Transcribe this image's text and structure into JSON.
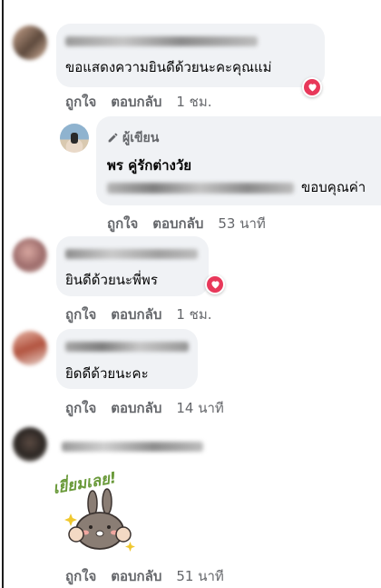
{
  "colors": {
    "accent": "#e8385a",
    "bubble": "#f0f2f5",
    "secondary_text": "#65676b"
  },
  "comments": [
    {
      "text": "ขอแสดงความยินดีด้วยนะคะคุณแม่",
      "like": "ถูกใจ",
      "reply": "ตอบกลับ",
      "time": "1 ชม.",
      "reaction": "heart"
    },
    {
      "author_label": "ผู้เขียน",
      "author_name": "พร คู่รักต่างวัย",
      "text_suffix": "ขอบคุณค่า",
      "like": "ถูกใจ",
      "reply": "ตอบกลับ",
      "time": "53 นาที"
    },
    {
      "text": "ยินดีด้วยนะพี่พร",
      "like": "ถูกใจ",
      "reply": "ตอบกลับ",
      "time": "1 ชม.",
      "reaction": "heart"
    },
    {
      "text": "ยิดดีด้วยนะคะ",
      "like": "ถูกใจ",
      "reply": "ตอบกลับ",
      "time": "14 นาที"
    },
    {
      "sticker_text": "เยี่ยมเลย!",
      "sticker_icon": "bunny-thumbs-up",
      "like": "ถูกใจ",
      "reply": "ตอบกลับ",
      "time": "51 นาที"
    }
  ]
}
